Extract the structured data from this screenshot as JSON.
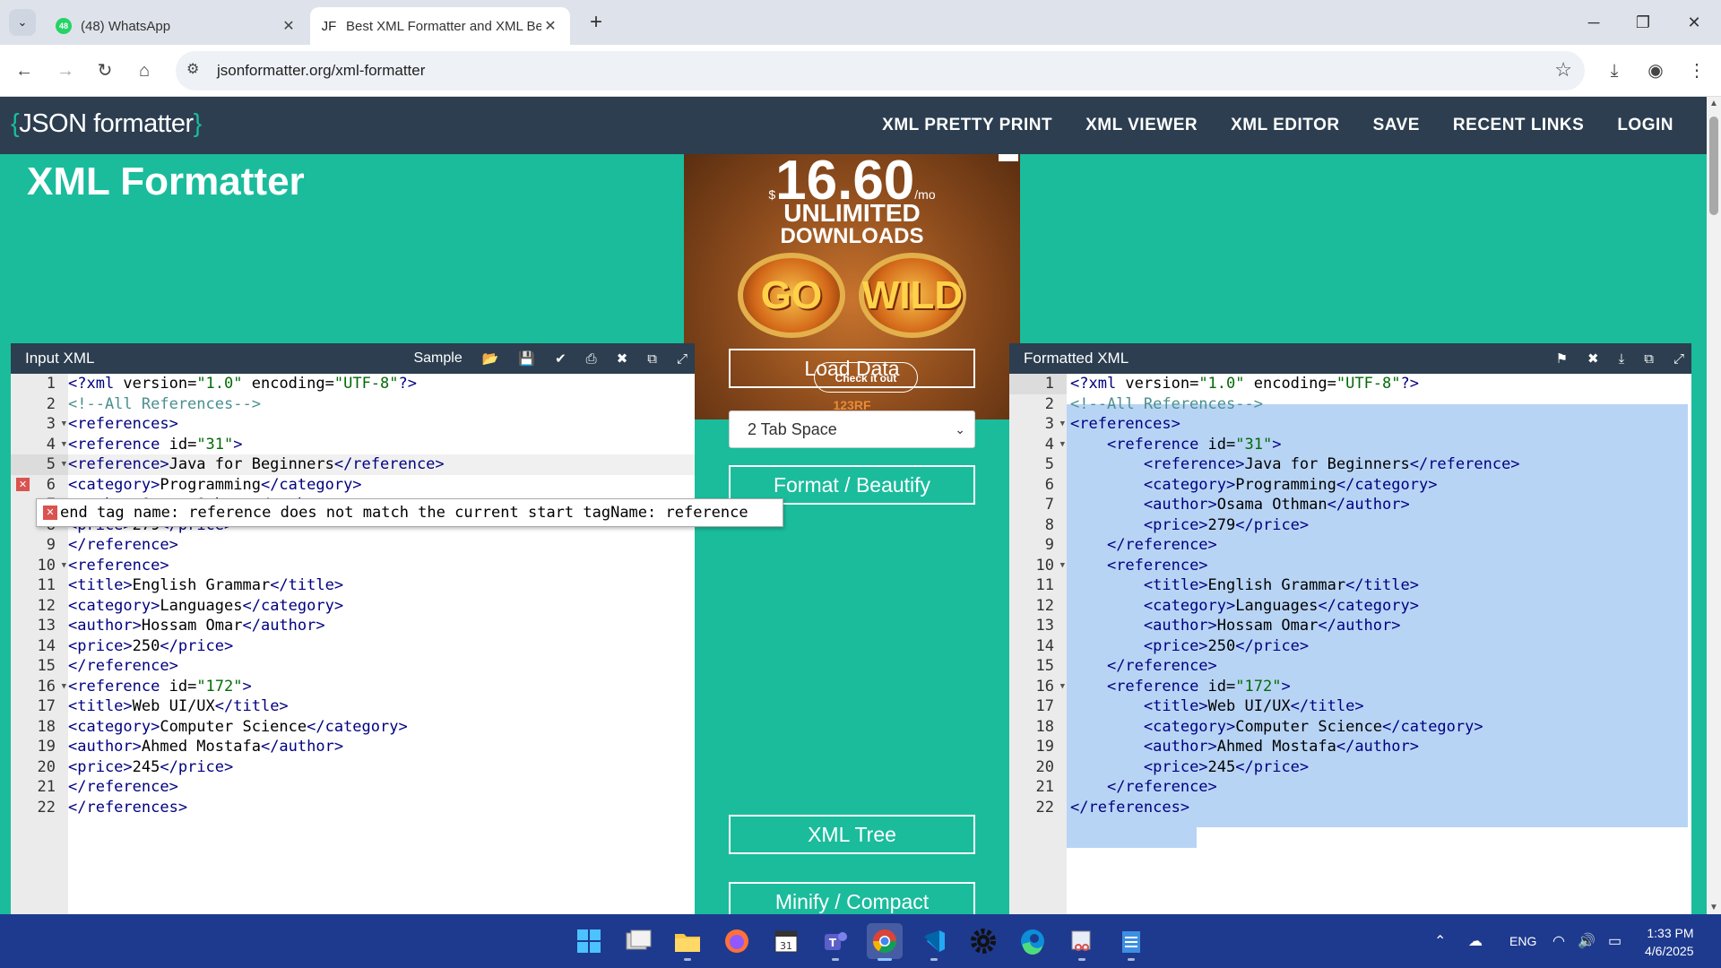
{
  "browser": {
    "tabs": [
      {
        "title": "(48) WhatsApp",
        "favicon": "whatsapp-icon",
        "badge": "48"
      },
      {
        "title": "Best XML Formatter and XML Bea",
        "favicon": "JF",
        "active": true
      }
    ],
    "url": "jsonformatter.org/xml-formatter"
  },
  "site": {
    "logo_open": "{",
    "logo_text": "JSON formatter",
    "logo_close": "}",
    "nav": [
      "XML PRETTY PRINT",
      "XML VIEWER",
      "XML EDITOR",
      "SAVE",
      "RECENT LINKS",
      "LOGIN"
    ],
    "page_title": "XML Formatter"
  },
  "ad": {
    "price": "16.60",
    "per": "/mo",
    "line1": "UNLIMITED",
    "line2": "DOWNLOADS",
    "glasses_left": "GO",
    "glasses_right": "WILD",
    "cta": "Check it out",
    "brand": "123RF"
  },
  "input_panel": {
    "title": "Input XML",
    "sample_label": "Sample",
    "tools": [
      "folder-open-icon",
      "save-icon",
      "check-icon",
      "print-icon",
      "close-icon",
      "copy-icon",
      "fullscreen-icon"
    ],
    "error_message": "end tag name: reference does not match the current start tagName: reference"
  },
  "output_panel": {
    "title": "Formatted XML",
    "tools": [
      "broom-icon",
      "close-icon",
      "download-icon",
      "copy-icon",
      "fullscreen-icon"
    ]
  },
  "controls": {
    "load_data": "Load Data",
    "indent_select": "2 Tab Space",
    "format_button": "Format / Beautify",
    "tree_button": "XML Tree",
    "minify_button": "Minify / Compact"
  },
  "taskbar": {
    "apps": [
      "windows-start-icon",
      "task-view-icon",
      "file-explorer-icon",
      "firefox-icon",
      "calendar-icon",
      "teams-icon",
      "chrome-icon",
      "vscode-icon",
      "settings-icon",
      "edge-icon",
      "snipping-tool-icon",
      "notepad-icon"
    ],
    "language": "ENG",
    "time": "1:33 PM",
    "date": "4/6/2025"
  },
  "colors": {
    "accent": "#1abc9c",
    "header": "#2c3e50",
    "selection": "#b8d4f5",
    "error": "#d9534f"
  }
}
